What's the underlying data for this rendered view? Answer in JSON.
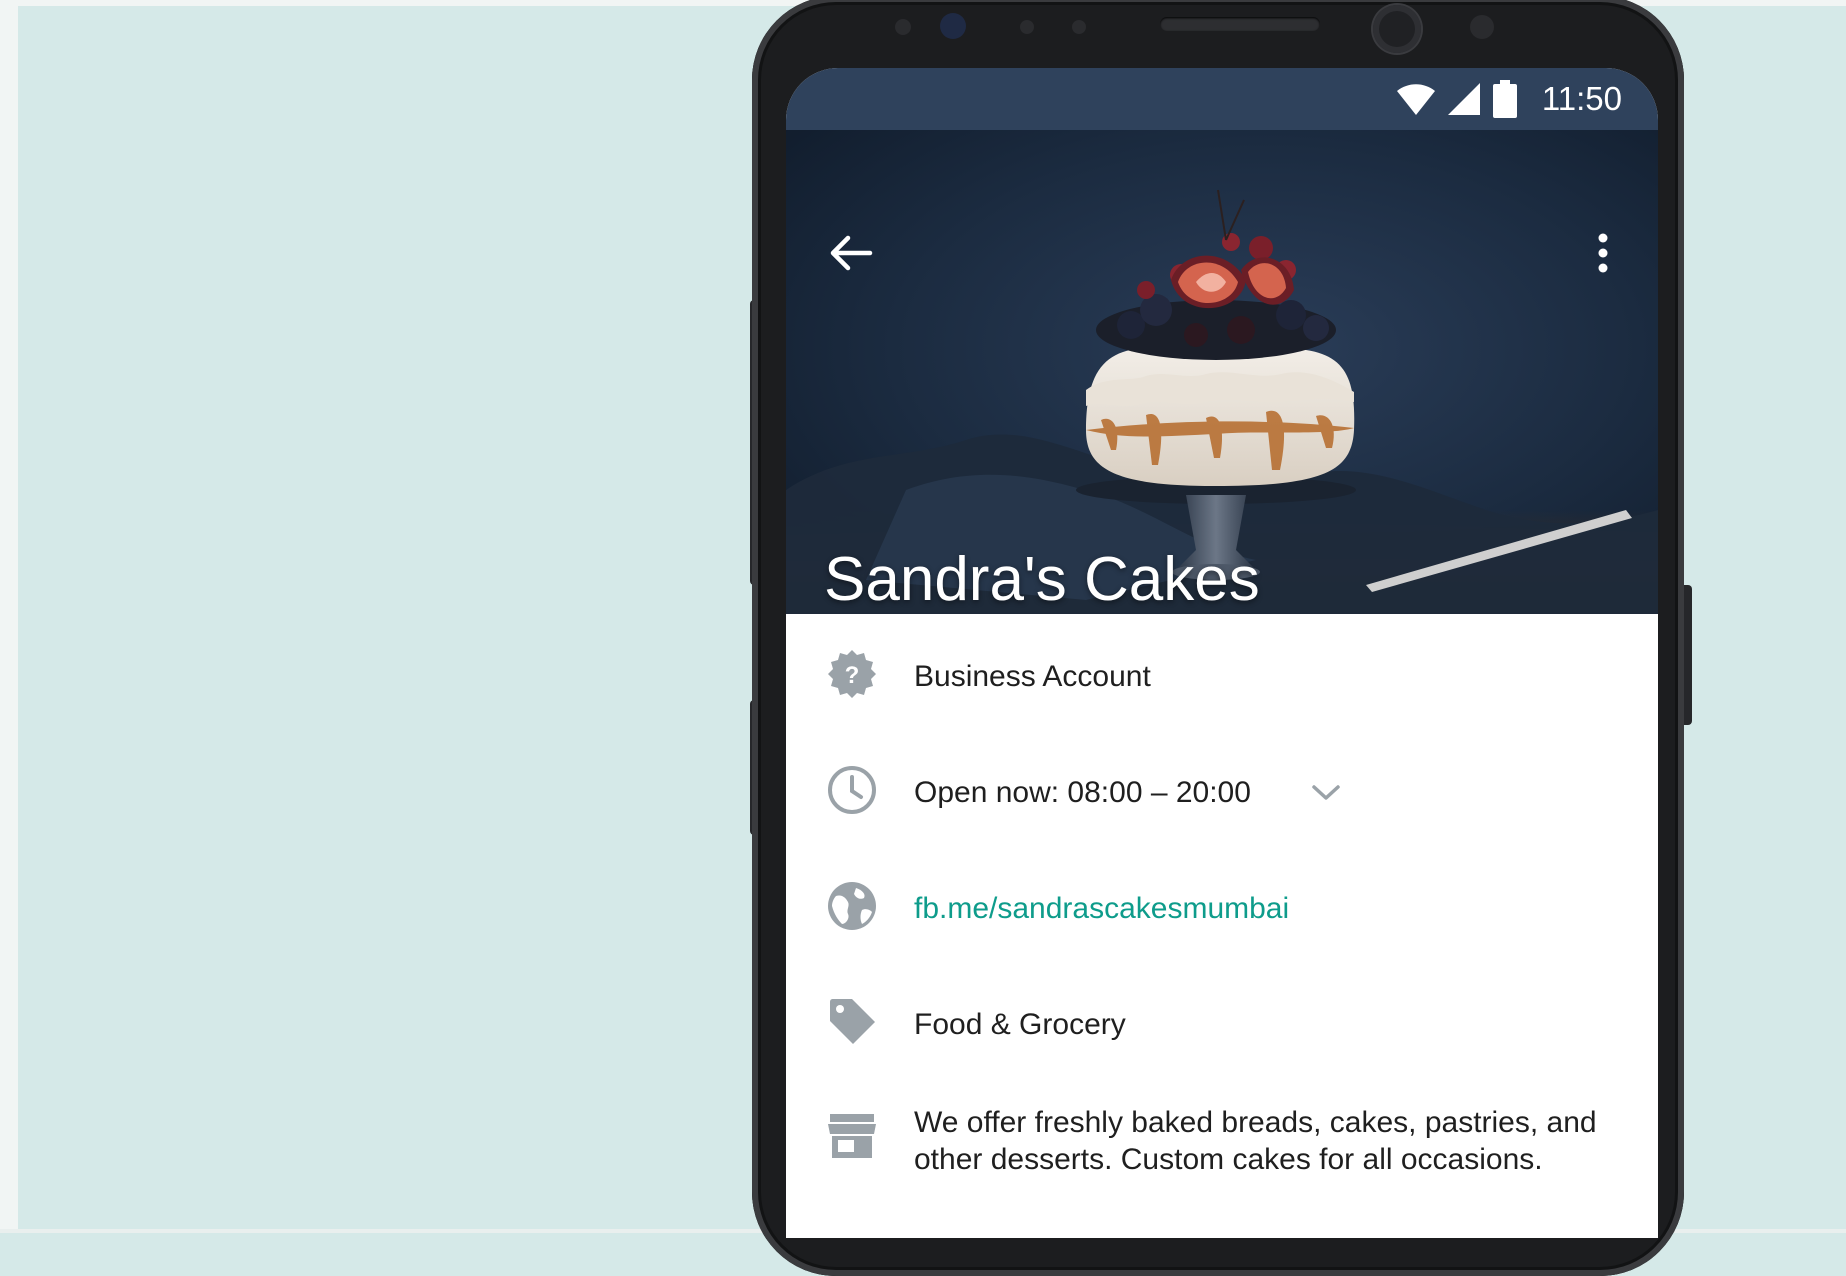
{
  "status_bar": {
    "time": "11:50",
    "icons": [
      "wifi-icon",
      "signal-icon",
      "battery-icon"
    ]
  },
  "header": {
    "back_icon": "arrow-left-icon",
    "menu_icon": "more-vertical-icon",
    "business_name": "Sandra's Cakes"
  },
  "info": {
    "account_type": {
      "icon": "badge-question-icon",
      "label": "Business Account"
    },
    "hours": {
      "icon": "clock-icon",
      "label": "Open now: 08:00 – 20:00",
      "expand_icon": "chevron-down-icon"
    },
    "website": {
      "icon": "globe-icon",
      "label": "fb.me/sandrascakesmumbai"
    },
    "category": {
      "icon": "tag-icon",
      "label": "Food & Grocery"
    },
    "description": {
      "icon": "store-icon",
      "label": "We offer freshly baked breads, cakes, pastries, and other desserts. Custom cakes for all occasions."
    }
  },
  "colors": {
    "background": "#d5e9e8",
    "status_bar": "#2f425c",
    "link": "#0e9c8b",
    "icon_gray": "#8e969c"
  }
}
